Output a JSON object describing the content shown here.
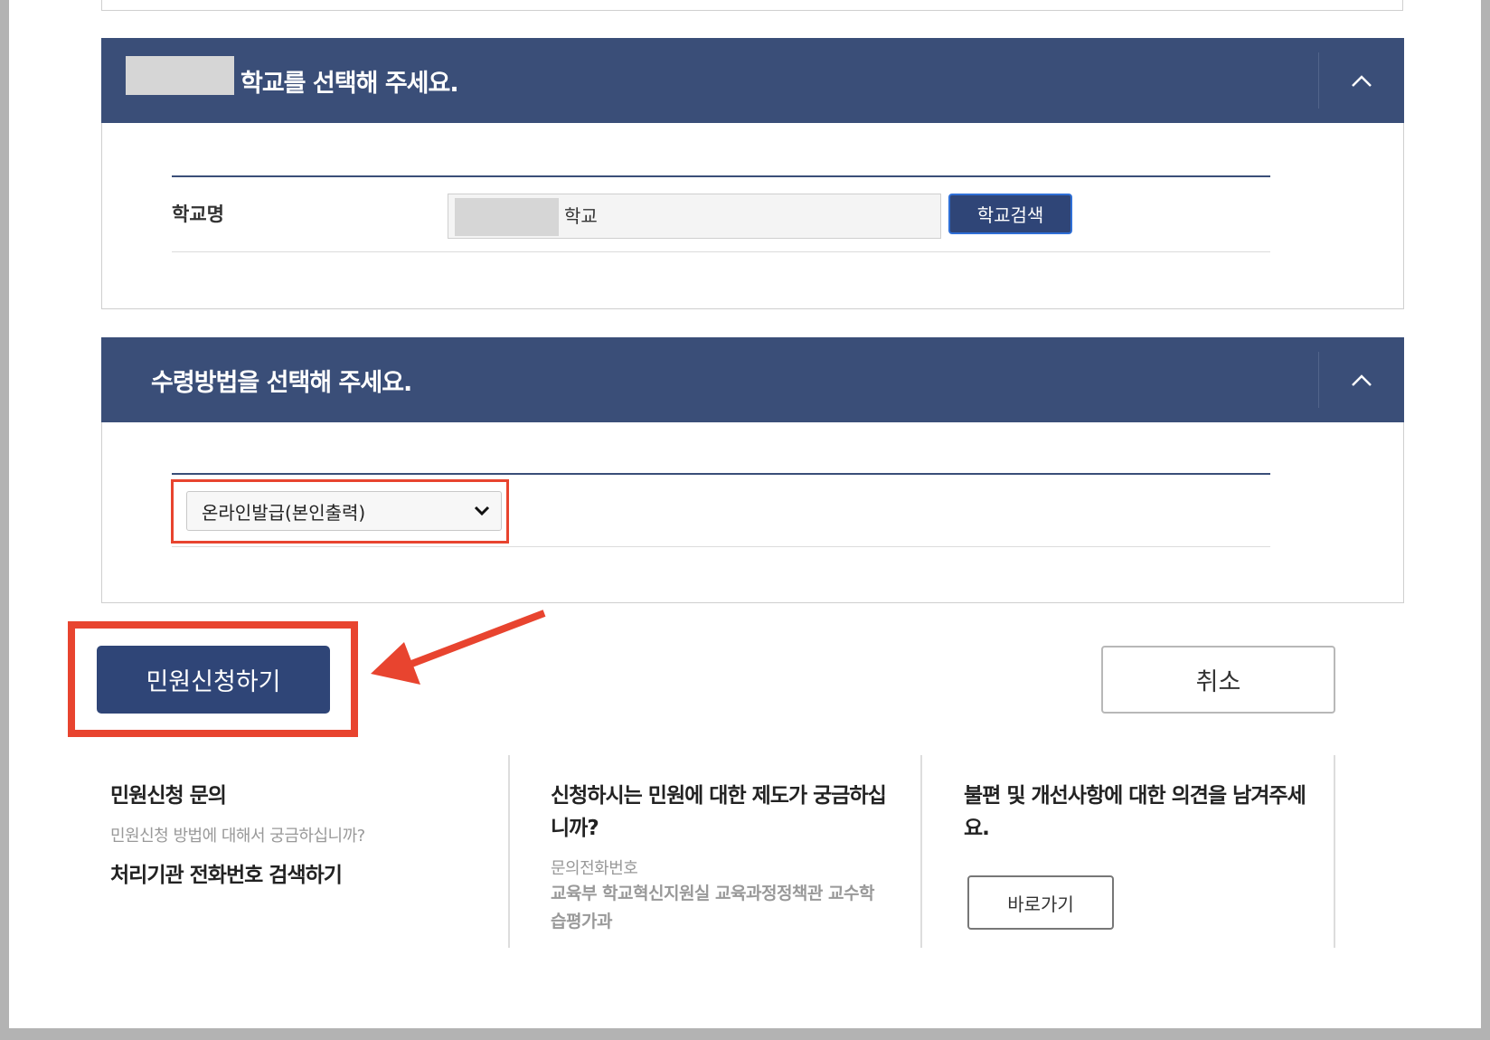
{
  "school_section": {
    "title": "학교를 선택해 주세요.",
    "field_label": "학교명",
    "school_value": "학교",
    "search_button": "학교검색"
  },
  "receive_section": {
    "title": "수령방법을 선택해 주세요.",
    "selected_method": "온라인발급(본인출력)"
  },
  "actions": {
    "submit_label": "민원신청하기",
    "cancel_label": "취소"
  },
  "info": {
    "col1": {
      "title": "민원신청 문의",
      "subtitle": "민원신청 방법에 대해서 궁금하십니까?",
      "link": "처리기관 전화번호 검색하기"
    },
    "col2": {
      "title_line1": "신청하시는 민원에 대한 제도가 궁금하십",
      "title_line2": "니까?",
      "phone_label": "문의전화번호",
      "org_line1": "교육부 학교혁신지원실 교육과정정책관 교수학",
      "org_line2": "습평가과"
    },
    "col3": {
      "title_line1": "불편 및 개선사항에 대한 의견을 남겨주세",
      "title_line2": "요.",
      "button": "바로가기"
    }
  },
  "colors": {
    "header_navy": "#3a4e78",
    "button_navy": "#2f4577",
    "highlight_red": "#e8442f"
  },
  "icons": {
    "collapse": "chevron-up-icon",
    "dropdown": "chevron-down-icon",
    "annotation": "arrow-icon"
  }
}
